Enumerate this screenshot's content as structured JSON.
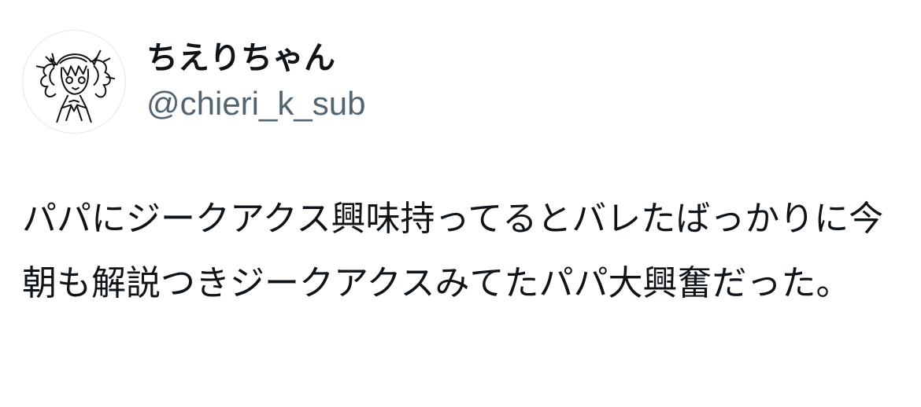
{
  "author": {
    "display_name": "ちえりちゃん",
    "handle": "@chieri_k_sub",
    "avatar_icon": "sketch-girl-avatar-icon"
  },
  "tweet": {
    "text": "パパにジークアクス興味持ってるとバレたばっかりに今朝も解説つきジークアクスみてたパパ大興奮だった。"
  },
  "colors": {
    "name": "#0f1419",
    "handle": "#536471",
    "text": "#0f1419",
    "background": "#ffffff"
  }
}
